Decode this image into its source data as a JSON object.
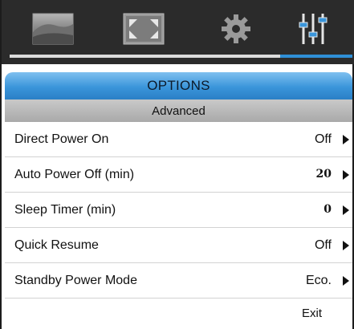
{
  "tabs": [
    {
      "icon": "image-icon",
      "active": false
    },
    {
      "icon": "display-icon",
      "active": false
    },
    {
      "icon": "setup-gear-icon",
      "active": false
    },
    {
      "icon": "options-sliders-icon",
      "active": true
    }
  ],
  "colors": {
    "tabbar_bg": "#2b2b2b",
    "accent": "#2f8fd6",
    "title_gradient_top": "#7fc0f0",
    "title_gradient_bottom": "#2a7fc6"
  },
  "progress": {
    "fraction": 0.21
  },
  "header": {
    "title": "OPTIONS",
    "subtitle": "Advanced"
  },
  "menu": [
    {
      "label": "Direct Power On",
      "value": "Off"
    },
    {
      "label": "Auto Power Off (min)",
      "value": "20"
    },
    {
      "label": "Sleep Timer (min)",
      "value": "0"
    },
    {
      "label": "Quick Resume",
      "value": "Off"
    },
    {
      "label": "Standby Power Mode",
      "value": "Eco."
    }
  ],
  "exit_label": "Exit"
}
